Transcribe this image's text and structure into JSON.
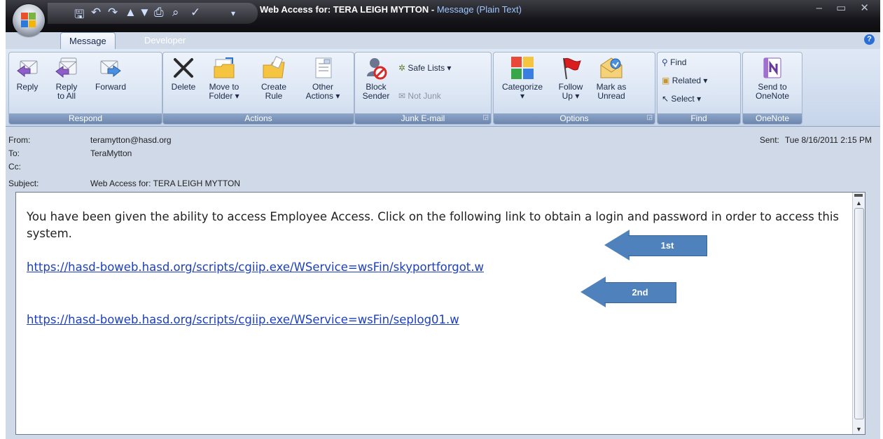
{
  "window": {
    "title": "Web Access for: TERA LEIGH MYTTON",
    "title_separator": " - ",
    "mode": "Message (Plain Text)",
    "buttons": "– ▭ ✕"
  },
  "quick_access": [
    "save-icon",
    "undo-icon",
    "redo-icon",
    "previous-item-icon",
    "next-item-icon",
    "print-icon",
    "print-preview-icon",
    "spelling-icon",
    "customize-icon"
  ],
  "tabs": [
    {
      "label": "Message",
      "active": true
    },
    {
      "label": "Developer",
      "active": false
    }
  ],
  "ribbon": {
    "respond": {
      "label": "Respond",
      "reply": "Reply",
      "reply_all_1": "Reply",
      "reply_all_2": "to All",
      "forward": "Forward"
    },
    "actions": {
      "label": "Actions",
      "delete": "Delete",
      "move_1": "Move to",
      "move_2": "Folder ▾",
      "create_1": "Create",
      "create_2": "Rule",
      "other_1": "Other",
      "other_2": "Actions ▾"
    },
    "junk": {
      "label": "Junk E-mail",
      "block_1": "Block",
      "block_2": "Sender",
      "safe_lists": "Safe Lists ▾",
      "not_junk": "Not Junk"
    },
    "options": {
      "label": "Options",
      "categorize_1": "Categorize",
      "categorize_2": "▾",
      "follow_1": "Follow",
      "follow_2": "Up ▾",
      "mark_1": "Mark as",
      "mark_2": "Unread"
    },
    "find": {
      "label": "Find",
      "find": "Find",
      "related": "Related ▾",
      "select": "Select ▾"
    },
    "onenote": {
      "label": "OneNote",
      "send_1": "Send to",
      "send_2": "OneNote"
    }
  },
  "header": {
    "from_label": "From:",
    "from": "teramytton@hasd.org",
    "to_label": "To:",
    "to": "TeraMytton",
    "cc_label": "Cc:",
    "cc": "",
    "subject_label": "Subject:",
    "subject": "Web Access for: TERA LEIGH MYTTON",
    "sent_label": "Sent:",
    "sent": "Tue 8/16/2011 2:15 PM"
  },
  "body": {
    "text": "You have been given the ability to access Employee Access.  Click on the following link to obtain a login and password in order to access this system.",
    "link1": "https://hasd-boweb.hasd.org/scripts/cgiip.exe/WService=wsFin/skyportforgot.w",
    "link2": "https://hasd-boweb.hasd.org/scripts/cgiip.exe/WService=wsFin/seplog01.w"
  },
  "annotations": {
    "arrow1": "1st",
    "arrow2": "2nd",
    "color": "#4f81bd"
  }
}
